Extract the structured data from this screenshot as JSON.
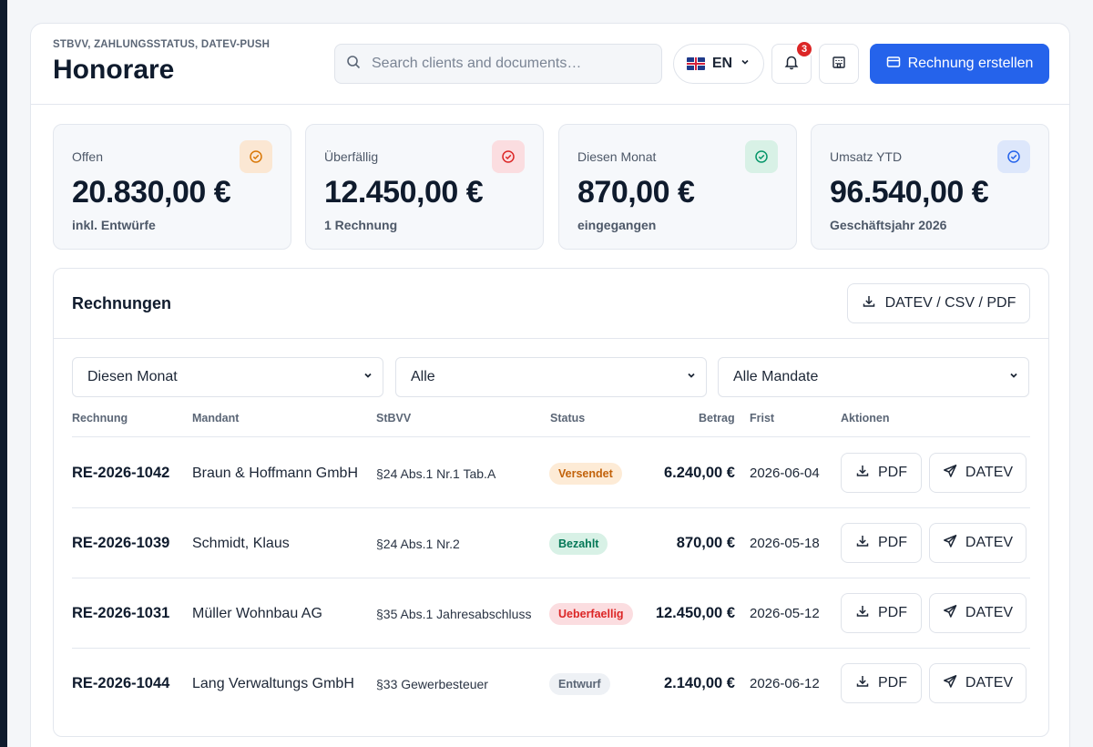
{
  "header": {
    "eyebrow": "STBVV, ZAHLUNGSSTATUS, DATEV-PUSH",
    "title": "Honorare",
    "search_placeholder": "Search clients and documents…",
    "language": "EN",
    "notifications_count": "3",
    "create_button": "Rechnung erstellen"
  },
  "stats": [
    {
      "label": "Offen",
      "value": "20.830,00 €",
      "sub": "inkl. Entwürfe",
      "icon": "check-circle-icon",
      "bg": "#fbe7d3",
      "color": "#d97706"
    },
    {
      "label": "Überfällig",
      "value": "12.450,00 €",
      "sub": "1 Rechnung",
      "icon": "check-circle-icon",
      "bg": "#fbdde0",
      "color": "#dc2626"
    },
    {
      "label": "Diesen Monat",
      "value": "870,00 €",
      "sub": "eingegangen",
      "icon": "check-circle-icon",
      "bg": "#d8f1e6",
      "color": "#059669"
    },
    {
      "label": "Umsatz YTD",
      "value": "96.540,00 €",
      "sub": "Geschäftsjahr 2026",
      "icon": "check-circle-icon",
      "bg": "#dde7fb",
      "color": "#2563eb"
    }
  ],
  "invoices": {
    "title": "Rechnungen",
    "export_button": "DATEV / CSV / PDF",
    "filters": [
      "Diesen Monat",
      "Alle",
      "Alle Mandate"
    ],
    "columns": {
      "number": "Rechnung",
      "client": "Mandant",
      "stbvv": "StBVV",
      "status": "Status",
      "amount": "Betrag",
      "due": "Frist",
      "actions": "Aktionen"
    },
    "pdf_label": "PDF",
    "datev_label": "DATEV",
    "rows": [
      {
        "number": "RE-2026-1042",
        "client": "Braun & Hoffmann GmbH",
        "stbvv": "§24 Abs.1 Nr.1 Tab.A",
        "status": "Versendet",
        "status_bg": "#fdebd6",
        "status_color": "#c2620a",
        "amount": "6.240,00 €",
        "due": "2026-06-04"
      },
      {
        "number": "RE-2026-1039",
        "client": "Schmidt, Klaus",
        "stbvv": "§24 Abs.1 Nr.2",
        "status": "Bezahlt",
        "status_bg": "#d8f1e6",
        "status_color": "#047857",
        "amount": "870,00 €",
        "due": "2026-05-18"
      },
      {
        "number": "RE-2026-1031",
        "client": "Müller Wohnbau AG",
        "stbvv": "§35 Abs.1 Jahresabschluss",
        "status": "Ueberfaellig",
        "status_bg": "#fbdde0",
        "status_color": "#dc2626",
        "amount": "12.450,00 €",
        "due": "2026-05-12"
      },
      {
        "number": "RE-2026-1044",
        "client": "Lang Verwaltungs GmbH",
        "stbvv": "§33 Gewerbesteuer",
        "status": "Entwurf",
        "status_bg": "#eef1f5",
        "status_color": "#5b6676",
        "amount": "2.140,00 €",
        "due": "2026-06-12"
      }
    ]
  }
}
